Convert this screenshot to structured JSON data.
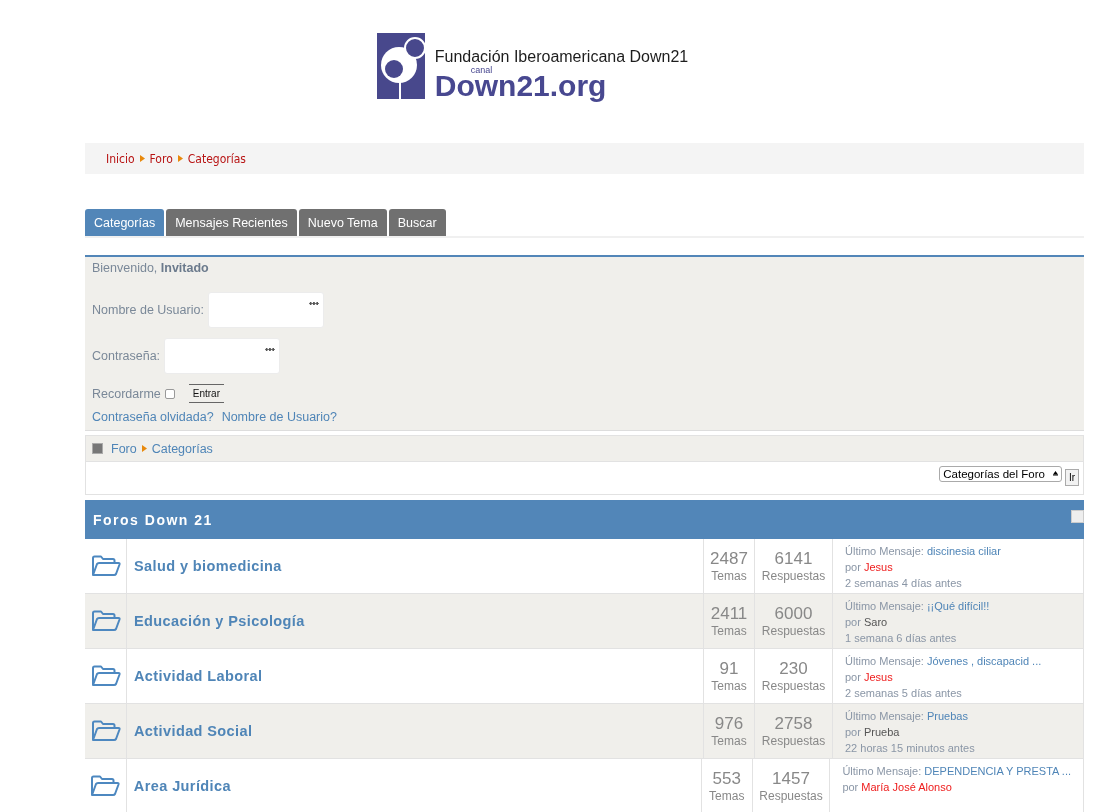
{
  "logo": {
    "title": "Fundación Iberoamericana Down21",
    "small": "canal",
    "name": "Down21.org"
  },
  "breadcrumb": [
    "Inicio",
    "Foro",
    "Categorías"
  ],
  "tabs": [
    {
      "label": "Categorías",
      "selected": true
    },
    {
      "label": "Mensajes Recientes",
      "selected": false
    },
    {
      "label": "Nuevo Tema",
      "selected": false
    },
    {
      "label": "Buscar",
      "selected": false
    }
  ],
  "login": {
    "welcome": "Bienvenido,",
    "user": "Invitado",
    "username_label": "Nombre de Usuario:",
    "password_label": "Contraseña:",
    "remember_label": "Recordarme",
    "remember_checked": false,
    "submit": "Entrar",
    "forgot_password": "Contraseña olvidada?",
    "forgot_username": "Nombre de Usuario?"
  },
  "pathway": [
    "Foro",
    "Categorías"
  ],
  "jump": {
    "value": "Categorías del Foro",
    "button": "Ir"
  },
  "section": {
    "title": "Foros Down 21"
  },
  "forums": [
    {
      "name": "Salud y biomedicina",
      "topics": "2487",
      "topics_label": "Temas",
      "replies": "6141",
      "replies_label": "Respuestas",
      "last_label": "Último Mensaje:",
      "last_subject": "discinesia ciliar",
      "by": "por",
      "author": "Jesus",
      "author_highlight": true,
      "time": "2 semanas 4 días antes"
    },
    {
      "name": "Educación y Psicología",
      "topics": "2411",
      "topics_label": "Temas",
      "replies": "6000",
      "replies_label": "Respuestas",
      "last_label": "Último Mensaje:",
      "last_subject": "¡¡Qué difícil!!",
      "by": "por",
      "author": "Saro",
      "author_highlight": false,
      "time": "1 semana 6 días antes"
    },
    {
      "name": "Actividad Laboral",
      "topics": "91",
      "topics_label": "Temas",
      "replies": "230",
      "replies_label": "Respuestas",
      "last_label": "Último Mensaje:",
      "last_subject": "Jóvenes , discapacid ...",
      "by": "por",
      "author": "Jesus",
      "author_highlight": true,
      "time": "2 semanas 5 días antes"
    },
    {
      "name": "Actividad Social",
      "topics": "976",
      "topics_label": "Temas",
      "replies": "2758",
      "replies_label": "Respuestas",
      "last_label": "Último Mensaje:",
      "last_subject": "Pruebas",
      "by": "por",
      "author": "Prueba",
      "author_highlight": false,
      "time": "22 horas 15 minutos antes"
    },
    {
      "name": "Area Jurídica",
      "topics": "553",
      "topics_label": "Temas",
      "replies": "1457",
      "replies_label": "Respuestas",
      "last_label": "Último Mensaje:",
      "last_subject": "DEPENDENCIA Y PRESTA ...",
      "by": "por",
      "author": "María José Alonso",
      "author_highlight": true
    }
  ]
}
